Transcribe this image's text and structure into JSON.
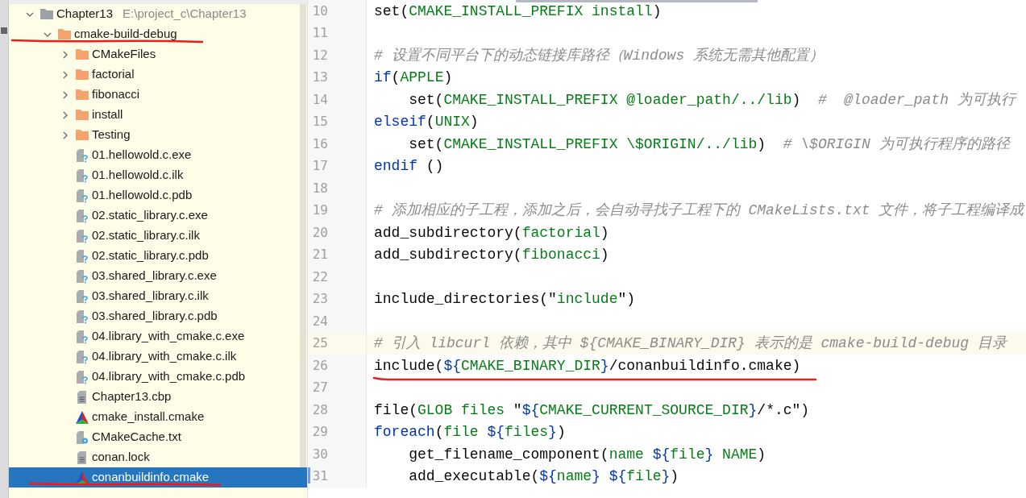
{
  "tree": [
    {
      "label": "Chapter13",
      "path": "E:\\project_c\\Chapter13",
      "kind": "project",
      "expanded": true,
      "selected": false,
      "underlined": false,
      "children": [
        {
          "label": "cmake-build-debug",
          "kind": "folder",
          "expanded": true,
          "selected": false,
          "underlined": true,
          "children": [
            {
              "label": "CMakeFiles",
              "kind": "folder",
              "expanded": false,
              "selected": false,
              "underlined": false
            },
            {
              "label": "factorial",
              "kind": "folder",
              "expanded": false,
              "selected": false,
              "underlined": false
            },
            {
              "label": "fibonacci",
              "kind": "folder",
              "expanded": false,
              "selected": false,
              "underlined": false
            },
            {
              "label": "install",
              "kind": "folder",
              "expanded": false,
              "selected": false,
              "underlined": false
            },
            {
              "label": "Testing",
              "kind": "folder",
              "expanded": false,
              "selected": false,
              "underlined": false
            },
            {
              "label": "01.hellowold.c.exe",
              "kind": "unknown",
              "selected": false,
              "underlined": false
            },
            {
              "label": "01.hellowold.c.ilk",
              "kind": "unknown",
              "selected": false,
              "underlined": false
            },
            {
              "label": "01.hellowold.c.pdb",
              "kind": "unknown",
              "selected": false,
              "underlined": false
            },
            {
              "label": "02.static_library.c.exe",
              "kind": "unknown",
              "selected": false,
              "underlined": false
            },
            {
              "label": "02.static_library.c.ilk",
              "kind": "unknown",
              "selected": false,
              "underlined": false
            },
            {
              "label": "02.static_library.c.pdb",
              "kind": "unknown",
              "selected": false,
              "underlined": false
            },
            {
              "label": "03.shared_library.c.exe",
              "kind": "unknown",
              "selected": false,
              "underlined": false
            },
            {
              "label": "03.shared_library.c.ilk",
              "kind": "unknown",
              "selected": false,
              "underlined": false
            },
            {
              "label": "03.shared_library.c.pdb",
              "kind": "unknown",
              "selected": false,
              "underlined": false
            },
            {
              "label": "04.library_with_cmake.c.exe",
              "kind": "unknown",
              "selected": false,
              "underlined": false
            },
            {
              "label": "04.library_with_cmake.c.ilk",
              "kind": "unknown",
              "selected": false,
              "underlined": false
            },
            {
              "label": "04.library_with_cmake.c.pdb",
              "kind": "unknown",
              "selected": false,
              "underlined": false
            },
            {
              "label": "Chapter13.cbp",
              "kind": "text",
              "selected": false,
              "underlined": false
            },
            {
              "label": "cmake_install.cmake",
              "kind": "cmake",
              "selected": false,
              "underlined": false
            },
            {
              "label": "CMakeCache.txt",
              "kind": "config",
              "selected": false,
              "underlined": false
            },
            {
              "label": "conan.lock",
              "kind": "text",
              "selected": false,
              "underlined": false
            },
            {
              "label": "conanbuildinfo.cmake",
              "kind": "cmake",
              "selected": true,
              "underlined": true
            }
          ]
        }
      ]
    }
  ],
  "editor": {
    "lines": [
      {
        "number": "10",
        "current": false,
        "modified": false,
        "underlined": false,
        "tokens": [
          {
            "kind": "plain",
            "text": "set("
          },
          {
            "kind": "arg",
            "text": "CMAKE_INSTALL_PREFIX install"
          },
          {
            "kind": "plain",
            "text": ")"
          }
        ]
      },
      {
        "number": "11",
        "current": false,
        "modified": false,
        "underlined": false
      },
      {
        "number": "12",
        "current": false,
        "modified": false,
        "underlined": false,
        "tokens": [
          {
            "kind": "comment",
            "text": "# 设置不同平台下的动态链接库路径（Windows 系统无需其他配置）"
          }
        ]
      },
      {
        "number": "13",
        "current": false,
        "modified": false,
        "underlined": false,
        "tokens": [
          {
            "kind": "keyword",
            "text": "if"
          },
          {
            "kind": "plain",
            "text": "("
          },
          {
            "kind": "arg",
            "text": "APPLE"
          },
          {
            "kind": "plain",
            "text": ")"
          }
        ]
      },
      {
        "number": "14",
        "current": false,
        "modified": false,
        "underlined": false,
        "tokens": [
          {
            "kind": "plain",
            "text": "    set("
          },
          {
            "kind": "arg",
            "text": "CMAKE_INSTALL_PREFIX @loader_path/../lib"
          },
          {
            "kind": "plain",
            "text": ")  "
          },
          {
            "kind": "comment",
            "text": "#  @loader_path 为可执行"
          }
        ]
      },
      {
        "number": "15",
        "current": false,
        "modified": false,
        "underlined": false,
        "tokens": [
          {
            "kind": "keyword",
            "text": "elseif"
          },
          {
            "kind": "plain",
            "text": "("
          },
          {
            "kind": "arg",
            "text": "UNIX"
          },
          {
            "kind": "plain",
            "text": ")"
          }
        ]
      },
      {
        "number": "16",
        "current": false,
        "modified": false,
        "underlined": false,
        "tokens": [
          {
            "kind": "plain",
            "text": "    set("
          },
          {
            "kind": "arg",
            "text": "CMAKE_INSTALL_PREFIX \\$ORIGIN/../lib"
          },
          {
            "kind": "plain",
            "text": ")  "
          },
          {
            "kind": "comment",
            "text": "# \\$ORIGIN 为可执行程序的路径"
          }
        ]
      },
      {
        "number": "17",
        "current": false,
        "modified": false,
        "underlined": false,
        "tokens": [
          {
            "kind": "keyword",
            "text": "endif"
          },
          {
            "kind": "plain",
            "text": " ()"
          }
        ]
      },
      {
        "number": "18",
        "current": false,
        "modified": false,
        "underlined": false
      },
      {
        "number": "19",
        "current": false,
        "modified": false,
        "underlined": false,
        "tokens": [
          {
            "kind": "comment",
            "text": "# 添加相应的子工程，添加之后，会自动寻找子工程下的 CMakeLists.txt 文件，将子工程编译成"
          }
        ]
      },
      {
        "number": "20",
        "current": false,
        "modified": false,
        "underlined": false,
        "tokens": [
          {
            "kind": "plain",
            "text": "add_subdirectory("
          },
          {
            "kind": "arg",
            "text": "factorial"
          },
          {
            "kind": "plain",
            "text": ")"
          }
        ]
      },
      {
        "number": "21",
        "current": false,
        "modified": false,
        "underlined": false,
        "tokens": [
          {
            "kind": "plain",
            "text": "add_subdirectory("
          },
          {
            "kind": "arg",
            "text": "fibonacci"
          },
          {
            "kind": "plain",
            "text": ")"
          }
        ]
      },
      {
        "number": "22",
        "current": false,
        "modified": false,
        "underlined": false
      },
      {
        "number": "23",
        "current": false,
        "modified": false,
        "underlined": false,
        "tokens": [
          {
            "kind": "plain",
            "text": "include_directories(\""
          },
          {
            "kind": "arg",
            "text": "include"
          },
          {
            "kind": "plain",
            "text": "\")"
          }
        ]
      },
      {
        "number": "24",
        "current": false,
        "modified": false,
        "underlined": false
      },
      {
        "number": "25",
        "current": true,
        "modified": false,
        "underlined": false,
        "tokens": [
          {
            "kind": "comment",
            "text": "# 引入 libcurl 依赖，其中 ${CMAKE_BINARY_DIR} 表示的是 cmake-build-debug 目录"
          }
        ]
      },
      {
        "number": "26",
        "current": false,
        "modified": false,
        "underlined": true,
        "tokens": [
          {
            "kind": "plain",
            "text": "include("
          },
          {
            "kind": "var",
            "text": "${"
          },
          {
            "kind": "arg",
            "text": "CMAKE_BINARY_DIR"
          },
          {
            "kind": "var",
            "text": "}"
          },
          {
            "kind": "plain",
            "text": "/conanbuildinfo.cmake)"
          }
        ]
      },
      {
        "number": "27",
        "current": false,
        "modified": false,
        "underlined": false
      },
      {
        "number": "28",
        "current": false,
        "modified": false,
        "underlined": false,
        "tokens": [
          {
            "kind": "plain",
            "text": "file("
          },
          {
            "kind": "arg",
            "text": "GLOB files "
          },
          {
            "kind": "plain",
            "text": "\""
          },
          {
            "kind": "var",
            "text": "${"
          },
          {
            "kind": "arg",
            "text": "CMAKE_CURRENT_SOURCE_DIR"
          },
          {
            "kind": "var",
            "text": "}"
          },
          {
            "kind": "plain",
            "text": "/*.c\")"
          }
        ]
      },
      {
        "number": "29",
        "current": false,
        "modified": false,
        "underlined": false,
        "tokens": [
          {
            "kind": "keyword",
            "text": "foreach"
          },
          {
            "kind": "plain",
            "text": "("
          },
          {
            "kind": "arg",
            "text": "file "
          },
          {
            "kind": "var",
            "text": "${"
          },
          {
            "kind": "arg",
            "text": "files"
          },
          {
            "kind": "var",
            "text": "}"
          },
          {
            "kind": "plain",
            "text": ")"
          }
        ]
      },
      {
        "number": "30",
        "current": false,
        "modified": false,
        "underlined": false,
        "tokens": [
          {
            "kind": "plain",
            "text": "    get_filename_component("
          },
          {
            "kind": "arg",
            "text": "name "
          },
          {
            "kind": "var",
            "text": "${"
          },
          {
            "kind": "arg",
            "text": "file"
          },
          {
            "kind": "var",
            "text": "}"
          },
          {
            "kind": "arg",
            "text": " NAME"
          },
          {
            "kind": "plain",
            "text": ")"
          }
        ]
      },
      {
        "number": "31",
        "current": false,
        "modified": true,
        "underlined": false,
        "tokens": [
          {
            "kind": "plain",
            "text": "    add_executable("
          },
          {
            "kind": "var",
            "text": "${"
          },
          {
            "kind": "arg",
            "text": "name"
          },
          {
            "kind": "var",
            "text": "}"
          },
          {
            "kind": "var",
            "text": " ${"
          },
          {
            "kind": "arg",
            "text": "file"
          },
          {
            "kind": "var",
            "text": "}"
          },
          {
            "kind": "plain",
            "text": ")"
          }
        ]
      }
    ]
  }
}
